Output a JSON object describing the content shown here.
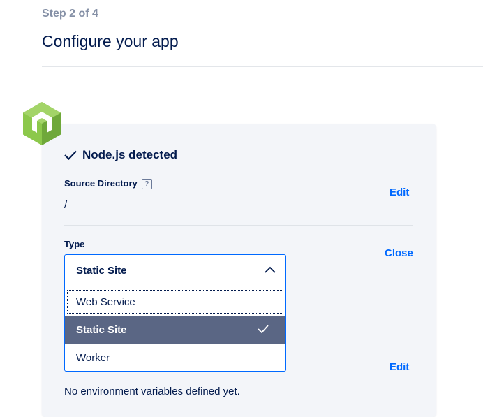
{
  "header": {
    "step": "Step 2 of 4",
    "title": "Configure your app"
  },
  "component": {
    "detected_label": "Node.js detected",
    "logo_icon": "nodejs-hexagon-icon",
    "source_directory": {
      "label": "Source Directory",
      "help_icon": "?",
      "value": "/",
      "action": "Edit"
    },
    "type": {
      "label": "Type",
      "action": "Close",
      "selected": "Static Site",
      "options": [
        {
          "label": "Web Service",
          "state": "focused"
        },
        {
          "label": "Static Site",
          "state": "selected"
        },
        {
          "label": "Worker",
          "state": "normal"
        }
      ]
    },
    "env": {
      "action": "Edit",
      "empty_text": "No environment variables defined yet."
    }
  },
  "colors": {
    "accent": "#0069ff",
    "text": "#031b4e",
    "muted": "#8590a6",
    "selected_bg": "#5a6684",
    "card_bg": "#f3f5f9",
    "node_green": "#8cc84b"
  }
}
